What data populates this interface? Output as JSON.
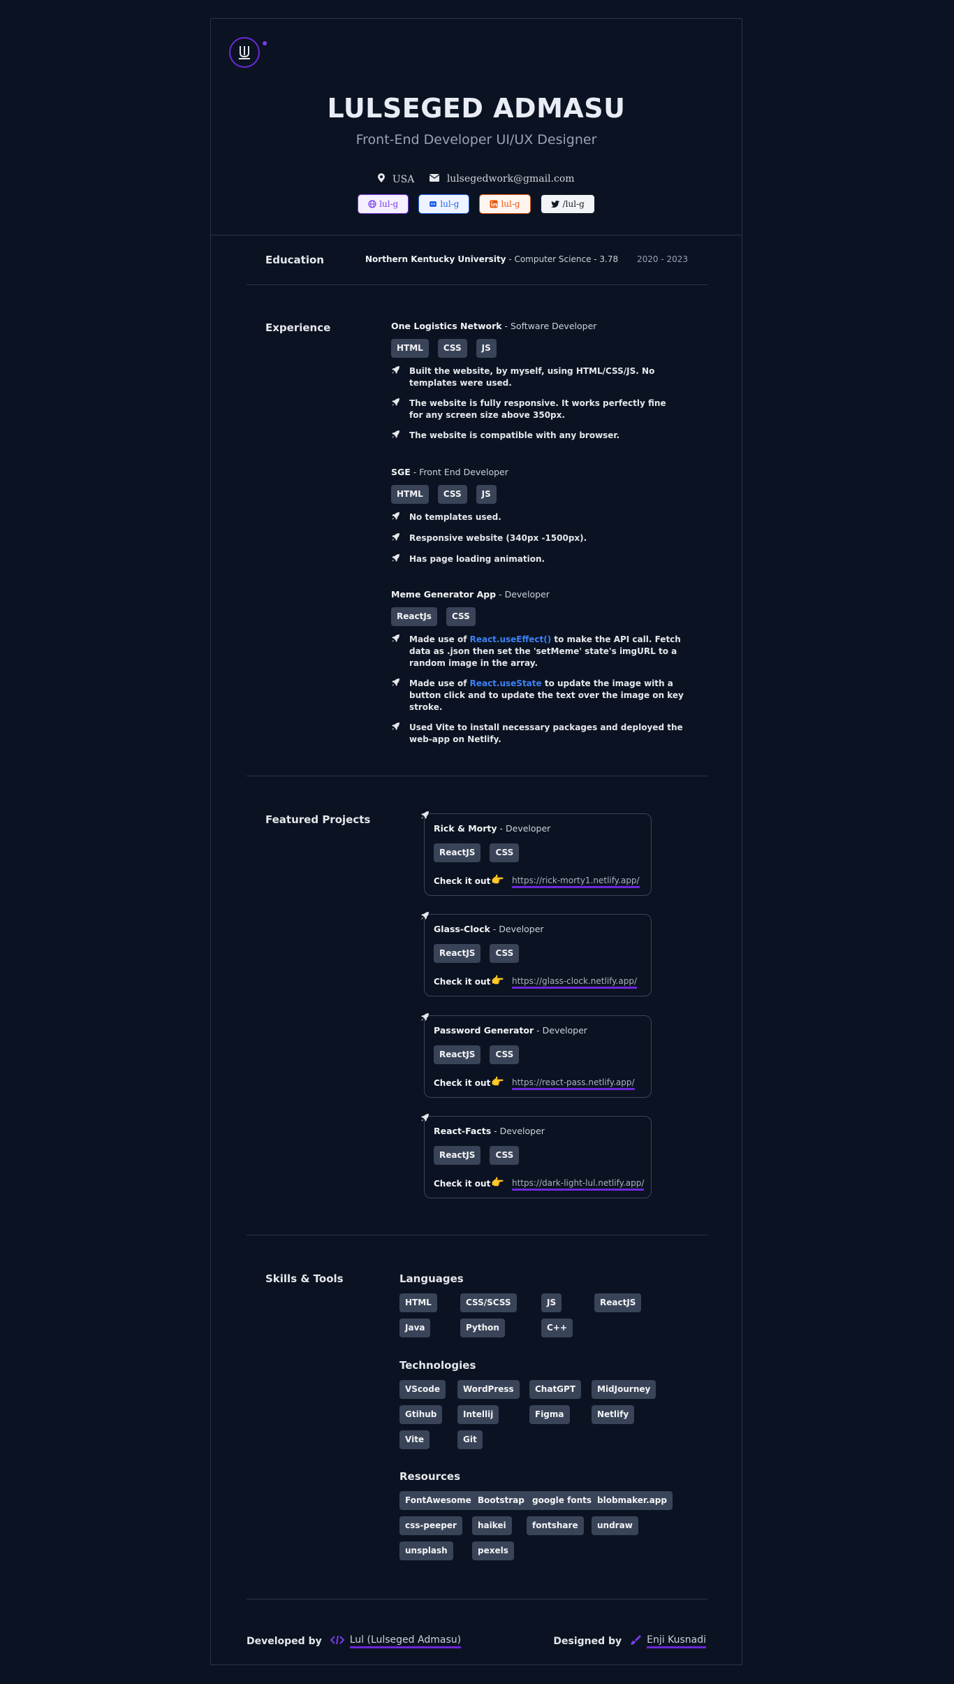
{
  "header": {
    "name": "LULSEGED ADMASU",
    "role": "Front-End Developer UI/UX Designer",
    "location": "USA",
    "email": "lulsegedwork@gmail.com",
    "socials": [
      {
        "label": "lul-g",
        "icon": "globe-icon",
        "color": "#7c3aed",
        "bg": "#f4f0ff"
      },
      {
        "label": "lul-g",
        "icon": "github-icon",
        "color": "#2563eb",
        "bg": "#eef4ff"
      },
      {
        "label": "lul-g",
        "icon": "linkedin-icon",
        "color": "#ea580c",
        "bg": "#fff5f0"
      },
      {
        "label": "/lul-g",
        "icon": "twitter-icon",
        "color": "#111827",
        "bg": "#f3f4f6"
      }
    ]
  },
  "education": {
    "title": "Education",
    "school": "Northern Kentucky University",
    "detail": " - Computer Science - 3.78",
    "years": "2020 - 2023"
  },
  "experience": {
    "title": "Experience",
    "jobs": [
      {
        "company": "One Logistics Network",
        "role": " - Software Developer",
        "tags": [
          "HTML",
          "CSS",
          "JS"
        ],
        "bullets": [
          "Built the website, by myself, using HTML/CSS/JS. No templates were used.",
          "The website is fully responsive. It works perfectly fine for any screen size above 350px.",
          "The website is compatible with any browser."
        ]
      },
      {
        "company": "SGE",
        "role": " - Front End Developer",
        "tags": [
          "HTML",
          "CSS",
          "JS"
        ],
        "bullets": [
          "No templates used.",
          "Responsive website (340px -1500px).",
          "Has page loading animation."
        ]
      },
      {
        "company": "Meme Generator App",
        "role": " - Developer",
        "tags": [
          "ReactJs",
          "CSS"
        ],
        "bullets_rich": [
          {
            "pre": "Made use of ",
            "link": "React.useEffect()",
            "post": " to make the API call. Fetch data as .json then set the 'setMeme' state's imgURL to a random image in the array."
          },
          {
            "pre": "Made use of ",
            "link": "React.useState",
            "post": " to update the image with a button click and to update the text over the image on key stroke."
          },
          {
            "pre": "Used Vite to install necessary packages and deployed the web-app on Netlify.",
            "link": "",
            "post": ""
          }
        ]
      }
    ]
  },
  "projects": {
    "title": "Featured Projects",
    "check_label": "Check it out",
    "items": [
      {
        "name": "Rick & Morty",
        "role": " - Developer",
        "tags": [
          "ReactJS",
          "CSS"
        ],
        "url": "https://rick-morty1.netlify.app/"
      },
      {
        "name": "Glass-Clock",
        "role": " - Developer",
        "tags": [
          "ReactJS",
          "CSS"
        ],
        "url": "https://glass-clock.netlify.app/"
      },
      {
        "name": "Password Generator",
        "role": " - Developer",
        "tags": [
          "ReactJS",
          "CSS"
        ],
        "url": "https://react-pass.netlify.app/"
      },
      {
        "name": "React-Facts",
        "role": " - Developer",
        "tags": [
          "ReactJS",
          "CSS"
        ],
        "url": "https://dark-light-lul.netlify.app/"
      }
    ]
  },
  "skills": {
    "title": "Skills & Tools",
    "languages_title": "Languages",
    "languages": [
      "HTML",
      "CSS/SCSS",
      "JS",
      "ReactJS",
      "Java",
      "Python",
      "C++"
    ],
    "technologies_title": "Technologies",
    "technologies": [
      "VScode",
      "WordPress",
      "ChatGPT",
      "MidJourney",
      "Gtihub",
      "Intellij",
      "Figma",
      "Netlify",
      "Vite",
      "Git"
    ],
    "resources_title": "Resources",
    "resources": [
      "FontAwesome",
      "Bootstrap",
      "google fonts",
      "blobmaker.app",
      "css-peeper",
      "haikei",
      "fontshare",
      "undraw",
      "unsplash",
      "pexels"
    ]
  },
  "footer": {
    "dev_label": "Developed by",
    "dev_name": "Lul (Lulseged Admasu)",
    "design_label": "Designed by",
    "design_name": "Enji Kusnadi"
  }
}
